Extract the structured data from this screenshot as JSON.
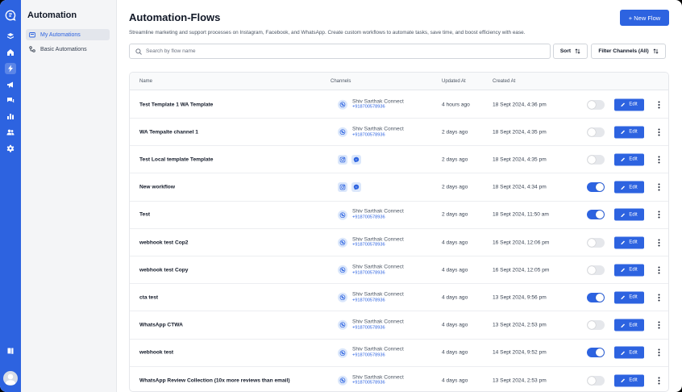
{
  "sidebar": {
    "title": "Automation",
    "items": [
      {
        "label": "My Automations",
        "active": true
      },
      {
        "label": "Basic Automations",
        "active": false
      }
    ]
  },
  "rail": {
    "icons": [
      "logo-icon",
      "layers-icon",
      "home-icon",
      "bolt-icon",
      "megaphone-icon",
      "chat-icon",
      "bar-chart-icon",
      "users-icon",
      "gear-icon",
      "book-icon",
      "avatar"
    ]
  },
  "header": {
    "title": "Automation-Flows",
    "subtitle": "Streamline marketing and support processes on Instagram, Facebook, and WhatsApp. Create custom workflows to automate tasks, save time, and boost efficiency with ease.",
    "new_flow_label": "+ New Flow"
  },
  "search": {
    "placeholder": "Search by flow name"
  },
  "sort_label": "Sort",
  "filter_label": "Filter Channels (All)",
  "table": {
    "headers": {
      "name": "Name",
      "channels": "Channels",
      "updated": "Updated At",
      "created": "Created At"
    },
    "edit_label": "Edit",
    "rows": [
      {
        "name": "Test Template 1 WA Template",
        "channel_type": "whatsapp",
        "channel_name": "Shiv Sarthak Connect",
        "channel_phone": "+918700578936",
        "updated": "4 hours ago",
        "created": "18 Sept 2024, 4:36 pm",
        "enabled": false
      },
      {
        "name": "WA Tempalte channel 1",
        "channel_type": "whatsapp",
        "channel_name": "Shiv Sarthak Connect",
        "channel_phone": "+918700578936",
        "updated": "2 days ago",
        "created": "18 Sept 2024, 4:35 pm",
        "enabled": false
      },
      {
        "name": "Test Local template Template",
        "channel_type": "social",
        "channel_name": "",
        "channel_phone": "",
        "updated": "2 days ago",
        "created": "18 Sept 2024, 4:35 pm",
        "enabled": false
      },
      {
        "name": "New workflow",
        "channel_type": "social",
        "channel_name": "",
        "channel_phone": "",
        "updated": "2 days ago",
        "created": "18 Sept 2024, 4:34 pm",
        "enabled": true
      },
      {
        "name": "Test",
        "channel_type": "whatsapp",
        "channel_name": "Shiv Sarthak Connect",
        "channel_phone": "+918700578936",
        "updated": "2 days ago",
        "created": "18 Sept 2024, 11:50 am",
        "enabled": true
      },
      {
        "name": "webhook test Cop2",
        "channel_type": "whatsapp",
        "channel_name": "Shiv Sarthak Connect",
        "channel_phone": "+918700578936",
        "updated": "4 days ago",
        "created": "16 Sept 2024, 12:06 pm",
        "enabled": false
      },
      {
        "name": "webhook test Copy",
        "channel_type": "whatsapp",
        "channel_name": "Shiv Sarthak Connect",
        "channel_phone": "+918700578936",
        "updated": "4 days ago",
        "created": "16 Sept 2024, 12:05 pm",
        "enabled": false
      },
      {
        "name": "cta test",
        "channel_type": "whatsapp",
        "channel_name": "Shiv Sarthak Connect",
        "channel_phone": "+918700578936",
        "updated": "4 days ago",
        "created": "13 Sept 2024, 9:56 pm",
        "enabled": true
      },
      {
        "name": "WhatsApp CTWA",
        "channel_type": "whatsapp",
        "channel_name": "Shiv Sarthak Connect",
        "channel_phone": "+918700578936",
        "updated": "4 days ago",
        "created": "13 Sept 2024, 2:53 pm",
        "enabled": false
      },
      {
        "name": "webhook test",
        "channel_type": "whatsapp",
        "channel_name": "Shiv Sarthak Connect",
        "channel_phone": "+918700578936",
        "updated": "4 days ago",
        "created": "14 Sept 2024, 9:52 pm",
        "enabled": true
      },
      {
        "name": "WhatsApp Review Collection (10x more reviews than email)",
        "channel_type": "whatsapp",
        "channel_name": "Shiv Sarthak Connect",
        "channel_phone": "+918700578936",
        "updated": "4 days ago",
        "created": "13 Sept 2024, 2:53 pm",
        "enabled": false
      }
    ]
  },
  "colors": {
    "accent": "#2d63e0",
    "rail": "#2d63e0",
    "sidebar_bg": "#f4f5f7",
    "toggle_off": "#e5e7eb"
  }
}
